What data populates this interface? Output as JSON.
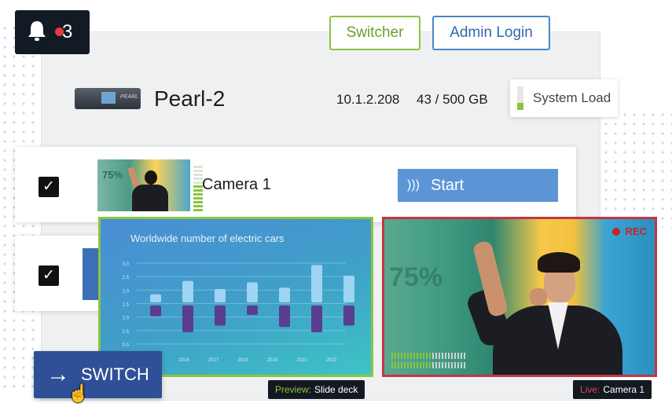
{
  "notifications": {
    "count": "3",
    "icon": "bell-icon"
  },
  "header_buttons": {
    "switcher": "Switcher",
    "admin_login": "Admin Login"
  },
  "device": {
    "name": "Pearl-2",
    "ip": "10.1.2.208",
    "storage": "43 / 500 GB",
    "brand": "PEARL"
  },
  "system_load": {
    "label": "System Load",
    "level": 0.3,
    "color": "#8bc53f"
  },
  "channels": [
    {
      "name": "Camera 1",
      "checked": true,
      "thumbnail_overlay": "75%",
      "action": "Start"
    },
    {
      "checked": true
    }
  ],
  "preview": {
    "tag_key": "Preview:",
    "tag_value": "Slide deck",
    "border_color": "#8bc53f"
  },
  "live": {
    "tag_key": "Live:",
    "tag_value": "Camera 1",
    "rec_label": "REC",
    "overlay_text": "75%",
    "border_color": "#c23742"
  },
  "switch_button": {
    "label": "SWITCH"
  },
  "chart_data": {
    "type": "bar",
    "title": "Worldwide number of electric cars",
    "categories": [
      "2016",
      "2017",
      "2018",
      "2019",
      "2021",
      "2022"
    ],
    "series": [
      {
        "values": [
          0.3,
          0.8,
          0.5,
          0.75,
          0.55,
          1.4,
          1.0
        ]
      },
      {
        "values": [
          -0.4,
          -1.0,
          -0.75,
          -0.35,
          -0.8,
          -1.0,
          -0.75
        ]
      }
    ],
    "y_ticks": [
      "3.0",
      "2.5",
      "2.0",
      "1.5",
      "1.0",
      "0.5",
      "0.0"
    ],
    "grid": true
  }
}
